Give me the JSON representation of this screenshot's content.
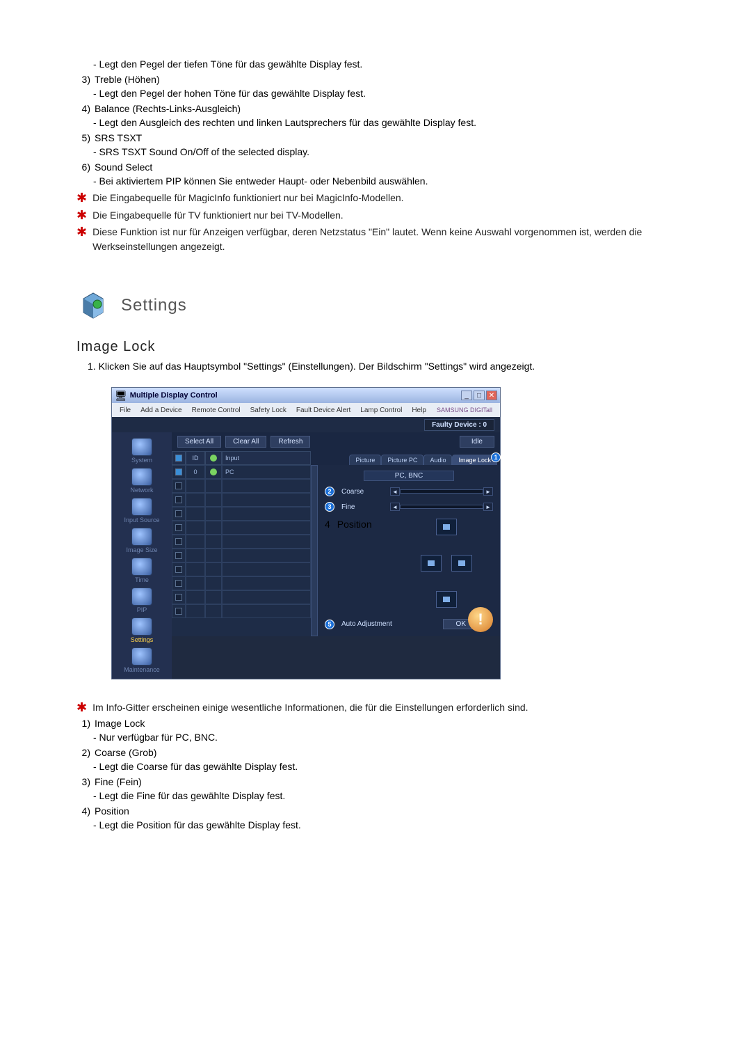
{
  "upper": {
    "line0": "- Legt den Pegel der tiefen Töne für das gewählte Display fest.",
    "items": [
      {
        "n": "3)",
        "t": "Treble (Höhen)",
        "d": "- Legt den Pegel der hohen Töne für das gewählte Display fest."
      },
      {
        "n": "4)",
        "t": "Balance (Rechts-Links-Ausgleich)",
        "d": "- Legt den Ausgleich des rechten und linken Lautsprechers für das gewählte Display fest."
      },
      {
        "n": "5)",
        "t": "SRS TSXT",
        "d": "- SRS TSXT Sound On/Off of the selected display."
      },
      {
        "n": "6)",
        "t": "Sound Select",
        "d": "- Bei aktiviertem PIP können Sie entweder Haupt- oder Nebenbild auswählen."
      }
    ],
    "stars": [
      "Die Eingabequelle für MagicInfo funktioniert nur bei MagicInfo-Modellen.",
      "Die Eingabequelle für TV funktioniert nur bei TV-Modellen.",
      "Diese Funktion ist nur für Anzeigen verfügbar, deren Netzstatus \"Ein\" lautet. Wenn keine Auswahl vorgenommen ist, werden die Werkseinstellungen angezeigt."
    ]
  },
  "section": {
    "title": "Settings",
    "sub": "Image Lock",
    "intro": "1.  Klicken Sie auf das Hauptsymbol \"Settings\" (Einstellungen). Der Bildschirm \"Settings\" wird angezeigt."
  },
  "screenshot": {
    "window_title": "Multiple Display Control",
    "menu": [
      "File",
      "Add a Device",
      "Remote Control",
      "Safety Lock",
      "Fault Device Alert",
      "Lamp Control",
      "Help"
    ],
    "brand": "SAMSUNG DIGITall",
    "faulty": "Faulty Device : 0",
    "toolbar": {
      "select_all": "Select All",
      "clear_all": "Clear All",
      "refresh": "Refresh",
      "idle": "Idle"
    },
    "sidebar": [
      "System",
      "Network",
      "Input Source",
      "Image Size",
      "Time",
      "PIP",
      "Settings",
      "Maintenance"
    ],
    "grid": {
      "hdr_id": "ID",
      "hdr_input": "Input",
      "row0_id": "0",
      "row0_input": "PC"
    },
    "tabs": [
      "Picture",
      "Picture PC",
      "Audio",
      "Image Lock"
    ],
    "panel": {
      "badge": "PC, BNC",
      "coarse": "Coarse",
      "fine": "Fine",
      "position": "Position",
      "auto": "Auto Adjustment",
      "ok": "OK"
    }
  },
  "lower": {
    "star": "Im Info-Gitter erscheinen einige wesentliche Informationen, die für die Einstellungen erforderlich sind.",
    "items": [
      {
        "n": "1)",
        "t": "Image Lock",
        "d": "- Nur verfügbar für PC, BNC."
      },
      {
        "n": "2)",
        "t": "Coarse (Grob)",
        "d": "- Legt die Coarse für das gewählte Display fest."
      },
      {
        "n": "3)",
        "t": "Fine (Fein)",
        "d": "- Legt die Fine für das gewählte Display fest."
      },
      {
        "n": "4)",
        "t": "Position",
        "d": "- Legt die Position für das gewählte Display fest."
      }
    ]
  }
}
